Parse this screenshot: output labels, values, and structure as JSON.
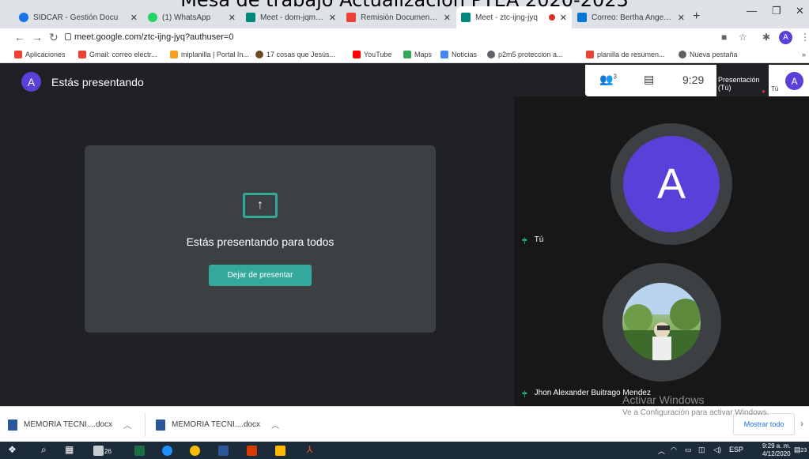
{
  "overlay_title": "Mesa de trabajo Actualización PTEA  2020-2023",
  "tabs": [
    {
      "label": "SIDCAR - Gestión Docu",
      "color": "#1a73e8"
    },
    {
      "label": "(1) WhatsApp",
      "color": "#25d366"
    },
    {
      "label": "Meet - dom-jqmt-ngd",
      "color": "#00897b"
    },
    {
      "label": "Remisión Documentaci",
      "color": "#ea4335"
    },
    {
      "label": "Meet - ztc-ijng-jyq",
      "color": "#00897b"
    },
    {
      "label": "Correo: Bertha Angelica",
      "color": "#0078d4"
    }
  ],
  "url": "meet.google.com/ztc-ijng-jyq?authuser=0",
  "profile_initial": "A",
  "bookmarks": [
    {
      "label": "Aplicaciones",
      "color": "#ea4335"
    },
    {
      "label": "Gmail: correo electr...",
      "color": "#ea4335"
    },
    {
      "label": "miplanilla | Portal In...",
      "color": "#f4a21b"
    },
    {
      "label": "17 cosas que Jesús...",
      "color": "#6b4a2a"
    },
    {
      "label": "YouTube",
      "color": "#ff0000"
    },
    {
      "label": "Maps",
      "color": "#34a853"
    },
    {
      "label": "Noticias",
      "color": "#4285f4"
    },
    {
      "label": "p2m5 proteccion a...",
      "color": "#5f6368"
    },
    {
      "label": "planilla de resumen...",
      "color": "#ea4335"
    },
    {
      "label": "Nueva pestaña",
      "color": "#5f6368"
    }
  ],
  "meet": {
    "avatar_initial": "A",
    "title": "Estás presentando",
    "present_message": "Estás presentando para todos",
    "stop_button": "Dejar de presentar",
    "participants_count": "3",
    "time": "9:29",
    "thumb_label": "Presentación (Tú)",
    "thumb_you": "Tú",
    "tile1_name": "Tú",
    "tile1_initial": "A",
    "tile2_name": "Jhon Alexander Buitrago Mendez"
  },
  "watermark": {
    "line1": "Activar Windows",
    "line2": "Ve a Configuración para activar Windows."
  },
  "downloads": [
    {
      "label": "MEMORIA TECNI....docx"
    },
    {
      "label": "MEMORIA TECNI....docx"
    }
  ],
  "show_all": "Mostrar todo",
  "taskbar": {
    "lang": "ESP",
    "time": "9:29 a. m.",
    "date": "4/12/2020",
    "badge_count": "26",
    "notif_count": "23"
  },
  "accent": "#34a89a"
}
